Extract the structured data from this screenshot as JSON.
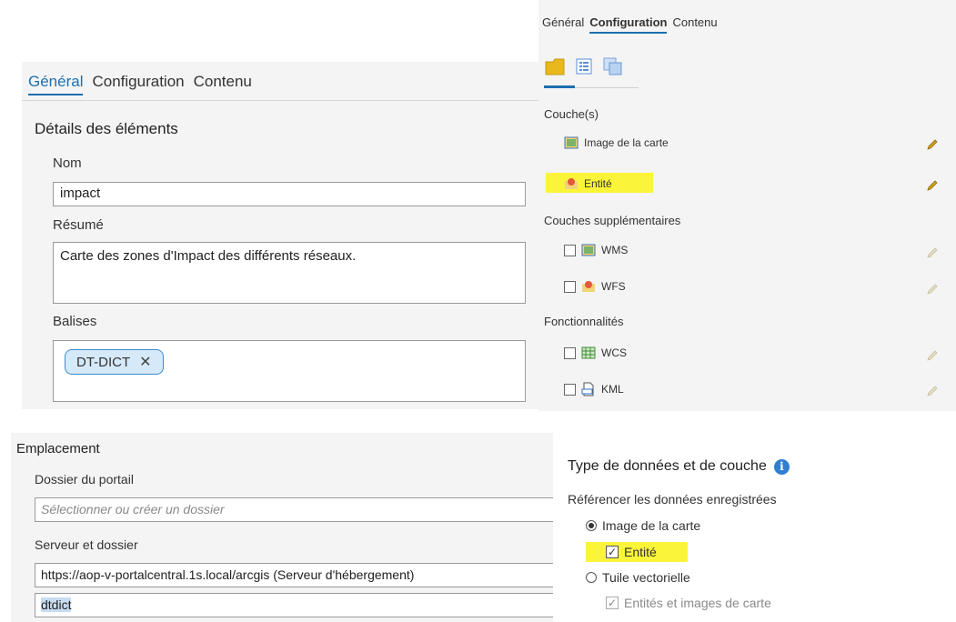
{
  "general_panel": {
    "tabs": [
      "Général",
      "Configuration",
      "Contenu"
    ],
    "section_title": "Détails des éléments",
    "name_label": "Nom",
    "name_value": "impact",
    "summary_label": "Résumé",
    "summary_value": "Carte des zones d'Impact des différents réseaux.",
    "tags_label": "Balises",
    "tags": [
      {
        "label": "DT-DICT",
        "remove": "✕"
      }
    ]
  },
  "config_panel": {
    "tabs": [
      "Général",
      "Configuration",
      "Contenu"
    ],
    "layers_heading": "Couche(s)",
    "layers": [
      {
        "label": "Image de la carte",
        "icon": "map-image-icon"
      },
      {
        "label": "Entité",
        "icon": "feature-icon",
        "highlighted": true
      }
    ],
    "extra_heading": "Couches supplémentaires",
    "extra_layers": [
      {
        "label": "WMS",
        "icon": "map-image-icon",
        "checked": false
      },
      {
        "label": "WFS",
        "icon": "feature-icon",
        "checked": false
      }
    ],
    "capabilities_heading": "Fonctionnalités",
    "capabilities": [
      {
        "label": "WCS",
        "icon": "grid-icon",
        "checked": false
      },
      {
        "label": "KML",
        "icon": "kml-icon",
        "checked": false
      }
    ]
  },
  "emplacement_panel": {
    "title": "Emplacement",
    "portal_folder_label": "Dossier du portail",
    "portal_folder_placeholder": "Sélectionner ou créer un dossier",
    "server_label": "Serveur et dossier",
    "server_value": "https://aop-v-portalcentral.1s.local/arcgis (Serveur d'hébergement)",
    "folder_value": "dtdict"
  },
  "type_panel": {
    "title": "Type de données et de couche",
    "info_glyph": "i",
    "reference_label": "Référencer les données enregistrées",
    "options": {
      "map_image": "Image de la carte",
      "feature": "Entité",
      "vector_tile": "Tuile vectorielle",
      "features_and_images": "Entités et images de carte"
    },
    "checkmark": "✓"
  },
  "colors": {
    "accent": "#1e6fb0",
    "highlight": "#fbf53a",
    "tag_border": "#3a8fd0",
    "info": "#2f7ed0"
  }
}
